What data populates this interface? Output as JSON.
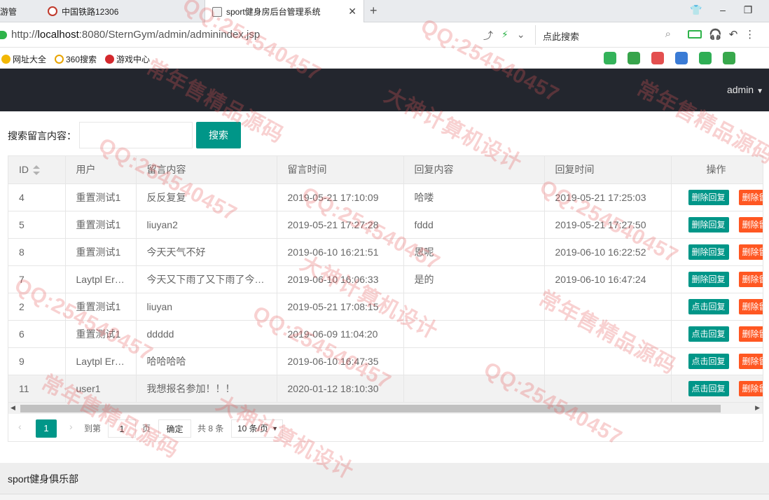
{
  "browser": {
    "tabs": [
      {
        "title": "游管"
      },
      {
        "title": "中国铁路12306"
      },
      {
        "title": "sport健身房后台管理系统"
      }
    ],
    "url_prefix": "http://",
    "url_host": "localhost",
    "url_rest": ":8080/SternGym/admin/adminindex.jsp",
    "search_placeholder": "点此搜索",
    "bookmarks": [
      {
        "label": "网址大全"
      },
      {
        "label": "360搜索"
      },
      {
        "label": "游戏中心"
      }
    ]
  },
  "header": {
    "user_menu": "admin"
  },
  "search": {
    "label": "搜索留言内容：",
    "input_value": "",
    "button": "搜索"
  },
  "table": {
    "columns": [
      "ID",
      "用户",
      "留言内容",
      "留言时间",
      "回复内容",
      "回复时间",
      "操作"
    ],
    "rows": [
      {
        "id": "4",
        "user": "重置测试1",
        "content": "反反复复",
        "time": "2019-05-21 17:10:09",
        "reply": "哈喽",
        "reply_time": "2019-05-21 17:25:03",
        "action1": "删除回复",
        "action2": "删除留言"
      },
      {
        "id": "5",
        "user": "重置测试1",
        "content": "liuyan2",
        "time": "2019-05-21 17:27:28",
        "reply": "fddd",
        "reply_time": "2019-05-21 17:27:50",
        "action1": "删除回复",
        "action2": "删除留言"
      },
      {
        "id": "8",
        "user": "重置测试1",
        "content": "今天天气不好",
        "time": "2019-06-10 16:21:51",
        "reply": "恩呢",
        "reply_time": "2019-06-10 16:22:52",
        "action1": "删除回复",
        "action2": "删除留言"
      },
      {
        "id": "7",
        "user": "Laytpl Error",
        "content": "今天又下雨了又下雨了今天又下雨了",
        "time": "2019-06-10 16:06:33",
        "reply": "是的",
        "reply_time": "2019-06-10 16:47:24",
        "action1": "删除回复",
        "action2": "删除留言"
      },
      {
        "id": "2",
        "user": "重置测试1",
        "content": "liuyan",
        "time": "2019-05-21 17:08:15",
        "reply": "",
        "reply_time": "",
        "action1": "点击回复",
        "action2": "删除留言"
      },
      {
        "id": "6",
        "user": "重置测试1",
        "content": "ddddd",
        "time": "2019-06-09 11:04:20",
        "reply": "",
        "reply_time": "",
        "action1": "点击回复",
        "action2": "删除留言"
      },
      {
        "id": "9",
        "user": "Laytpl Error",
        "content": "哈哈哈哈",
        "time": "2019-06-10 16:47:35",
        "reply": "",
        "reply_time": "",
        "action1": "点击回复",
        "action2": "删除留言"
      },
      {
        "id": "11",
        "user": "user1",
        "content": "我想报名参加！！！",
        "time": "2020-01-12 18:10:30",
        "reply": "",
        "reply_time": "",
        "action1": "点击回复",
        "action2": "删除留言"
      }
    ]
  },
  "pager": {
    "prev": "‹",
    "current": "1",
    "next": "›",
    "goto_label": "到第",
    "goto_value": "1",
    "page_label": "页",
    "confirm": "确定",
    "total": "共 8 条",
    "page_size": "10 条/页"
  },
  "footer": {
    "text": "sport健身俱乐部"
  },
  "watermarks": [
    "QQ:254540457",
    "常年售精品源码",
    "大神计算机设计"
  ],
  "colors": {
    "accent": "#009688",
    "danger": "#ff5722",
    "header_bg": "#23262e"
  }
}
